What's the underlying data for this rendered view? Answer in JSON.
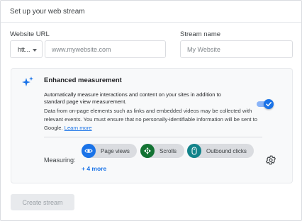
{
  "header": {
    "title": "Set up your web stream"
  },
  "form": {
    "website_url_label": "Website URL",
    "protocol_value": "htt...",
    "url_placeholder": "www.mywebsite.com",
    "stream_name_label": "Stream name",
    "stream_name_placeholder": "My Website"
  },
  "enhanced": {
    "title": "Enhanced measurement",
    "description_bold": "Automatically measure interactions and content on your sites in addition to standard page view measurement.",
    "description": "Data from on-page elements such as links and embedded videos may be collected with relevant events. You must ensure that no personally-identifiable information will be sent to Google.",
    "learn_more": "Learn more",
    "toggle_on": true,
    "icon": "sparkle-icon",
    "measuring_label": "Measuring:",
    "chips": [
      {
        "label": "Page views",
        "icon": "eye-icon",
        "color": "#1a73e8"
      },
      {
        "label": "Scrolls",
        "icon": "crosshair-icon",
        "color": "#137333"
      },
      {
        "label": "Outbound clicks",
        "icon": "mouse-icon",
        "color": "#12838a"
      }
    ],
    "more_label": "+ 4 more"
  },
  "actions": {
    "create_label": "Create stream"
  },
  "colors": {
    "accent": "#1a73e8",
    "panel_bg": "#f8f9fa"
  }
}
